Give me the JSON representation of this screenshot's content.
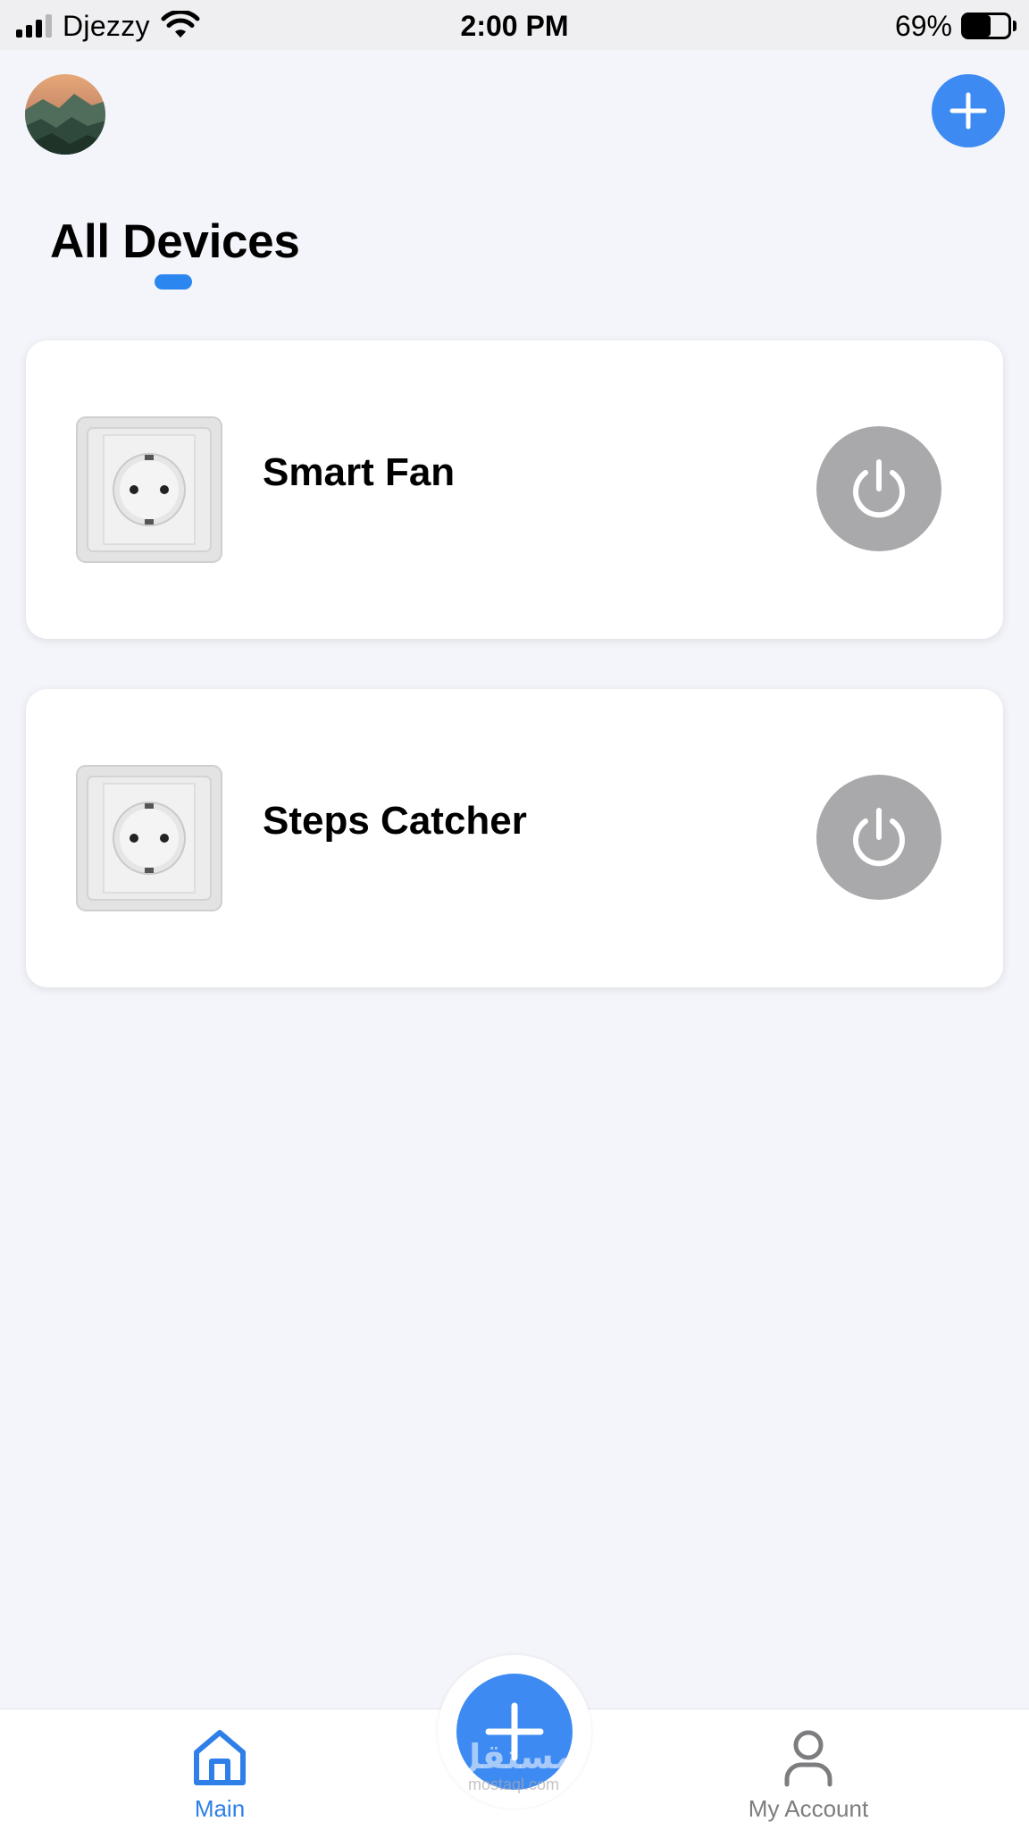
{
  "status_bar": {
    "carrier": "Djezzy",
    "time": "2:00 PM",
    "battery_percent": "69%",
    "battery_level": 0.69,
    "signal_bars": 3,
    "signal_total": 4,
    "icons": [
      "signal-icon",
      "wifi-icon",
      "battery-icon"
    ]
  },
  "header": {
    "avatar_icon": "avatar-landscape",
    "add_icon": "plus-icon"
  },
  "page": {
    "title": "All Devices"
  },
  "devices": [
    {
      "name": "Smart Fan",
      "icon": "power-socket-image",
      "power_icon": "power-icon",
      "power_state": "off"
    },
    {
      "name": "Steps Catcher",
      "icon": "power-socket-image",
      "power_icon": "power-icon",
      "power_state": "off"
    }
  ],
  "tab_bar": {
    "tabs": [
      {
        "label": "Main",
        "icon": "home-icon",
        "active": true
      },
      {
        "label": "My Account",
        "icon": "user-icon",
        "active": false
      }
    ],
    "fab_icon": "plus-icon"
  },
  "watermark": {
    "logo_text": "مستقل",
    "site": "mostaql.com"
  },
  "colors": {
    "background": "#f4f5fa",
    "accent": "#3d8bf2",
    "indicator": "#2c86f0",
    "power_button": "#a9a9ab",
    "active_tab": "#2e7fe8",
    "inactive_tab": "#7d7d80"
  }
}
